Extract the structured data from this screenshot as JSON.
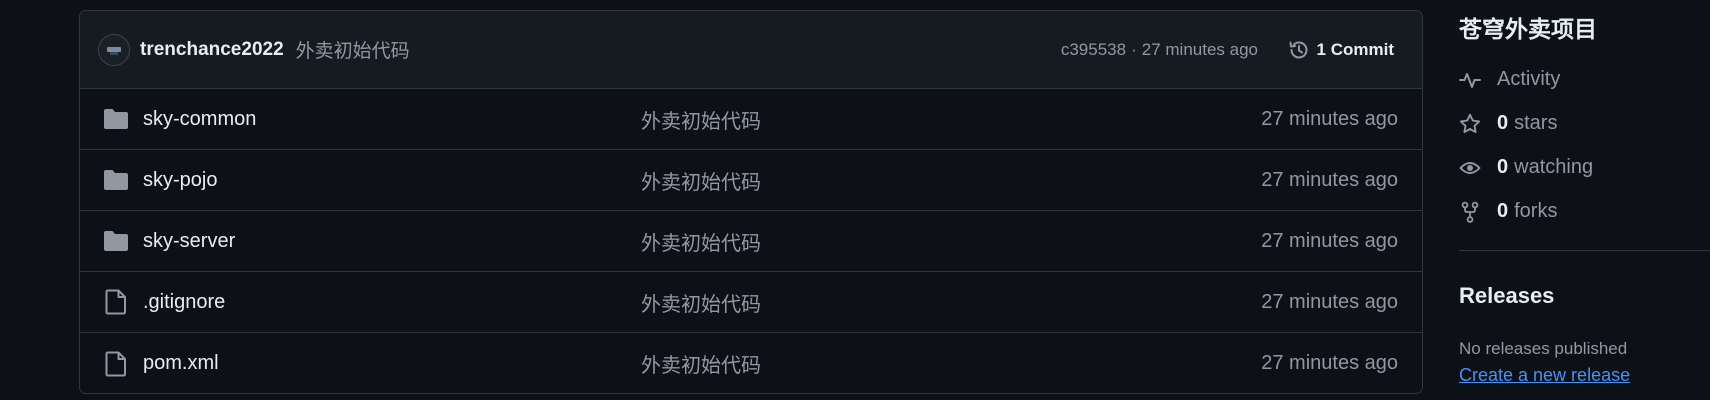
{
  "commit_header": {
    "author": "trenchance2022",
    "message": "外卖初始代码",
    "hash": "c395538",
    "separator": "·",
    "time": "27 minutes ago",
    "commit_count_label": "1 Commit"
  },
  "files": [
    {
      "name": "sky-common",
      "type": "folder",
      "commit": "外卖初始代码",
      "time": "27 minutes ago"
    },
    {
      "name": "sky-pojo",
      "type": "folder",
      "commit": "外卖初始代码",
      "time": "27 minutes ago"
    },
    {
      "name": "sky-server",
      "type": "folder",
      "commit": "外卖初始代码",
      "time": "27 minutes ago"
    },
    {
      "name": ".gitignore",
      "type": "file",
      "commit": "外卖初始代码",
      "time": "27 minutes ago"
    },
    {
      "name": "pom.xml",
      "type": "file",
      "commit": "外卖初始代码",
      "time": "27 minutes ago"
    }
  ],
  "sidebar": {
    "repo_title": "苍穹外卖项目",
    "activity_label": "Activity",
    "stars": {
      "count": "0",
      "label": "stars"
    },
    "watching": {
      "count": "0",
      "label": "watching"
    },
    "forks": {
      "count": "0",
      "label": "forks"
    },
    "releases_title": "Releases",
    "no_releases": "No releases published",
    "create_release": "Create a new release"
  },
  "icons": {
    "folder": "folder-icon",
    "file": "file-icon",
    "history": "history-icon",
    "activity": "pulse-icon",
    "star": "star-icon",
    "eye": "eye-icon",
    "fork": "fork-icon"
  },
  "colors": {
    "background": "#0d1117",
    "header_bg": "#161b22",
    "border": "#30363d",
    "text": "#e6edf3",
    "muted": "#9198a1",
    "link": "#4493f8"
  }
}
